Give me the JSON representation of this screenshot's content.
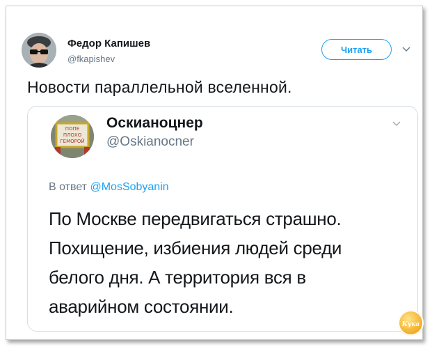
{
  "author": {
    "name": "Федор Капишев",
    "handle": "@fkapishev",
    "follow_label": "Читать"
  },
  "tweet": {
    "text": "Новости параллельной вселенной."
  },
  "quoted": {
    "name": "Оскианоцнер",
    "handle": "@Oskianocner",
    "avatar_sign_lines": [
      "ПОПЕ",
      "ПЛОХО",
      "ГЕМОРОЙ"
    ],
    "reply_prefix": "В ответ",
    "reply_to": "@MosSobyanin",
    "body_lines": [
      "По Москве передвигаться страшно.",
      "Похищение, избиения людей среди",
      "белого дня. А территория вся в",
      "аварийном состоянии."
    ]
  },
  "watermark": {
    "text": "Кука"
  },
  "colors": {
    "accent": "#1da1f2",
    "secondary_text": "#657786",
    "primary_text": "#14171a",
    "border": "#d6dde3"
  },
  "icons": {
    "menu": "chevron-down-icon",
    "quoted_menu": "chevron-down-icon"
  }
}
